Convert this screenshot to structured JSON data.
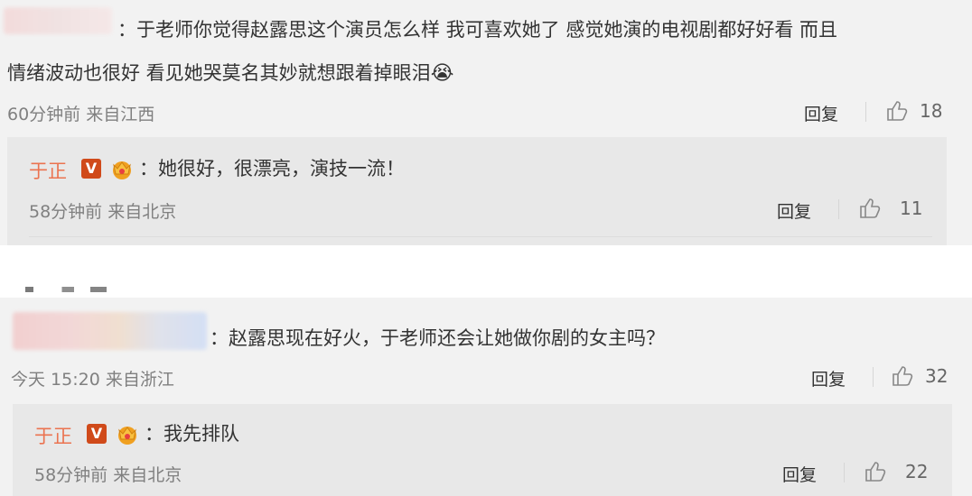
{
  "comments": [
    {
      "text_line1": "：于老师你觉得赵露思这个演员怎么样 我可喜欢她了 感觉她演的电视剧都好好看 而且",
      "text_line2": "情绪波动也很好 看见她哭莫名其妙就想跟着掉眼泪",
      "emoji": "😭",
      "meta": "60分钟前 来自江西",
      "reply_label": "回复",
      "likes": "18",
      "reply": {
        "author": "于正",
        "badge": "V",
        "text": "：她很好，很漂亮，演技一流！",
        "meta": "58分钟前 来自北京",
        "reply_label": "回复",
        "likes": "11"
      }
    },
    {
      "text_line1": "：赵露思现在好火，于老师还会让她做你剧的女主吗？",
      "meta": "今天 15:20 来自浙江",
      "reply_label": "回复",
      "likes": "32",
      "reply": {
        "author": "于正",
        "badge": "V",
        "text": "：我先排队",
        "meta": "58分钟前 来自北京",
        "reply_label": "回复",
        "likes": "22"
      }
    }
  ],
  "colors": {
    "author": "#eb7350",
    "meta": "#808080",
    "panel": "#f2f2f2",
    "reply_box": "#e8e8e8"
  },
  "icons": [
    "thumb-up-icon",
    "verified-v-icon",
    "crown-icon",
    "crying-emoji-icon"
  ]
}
